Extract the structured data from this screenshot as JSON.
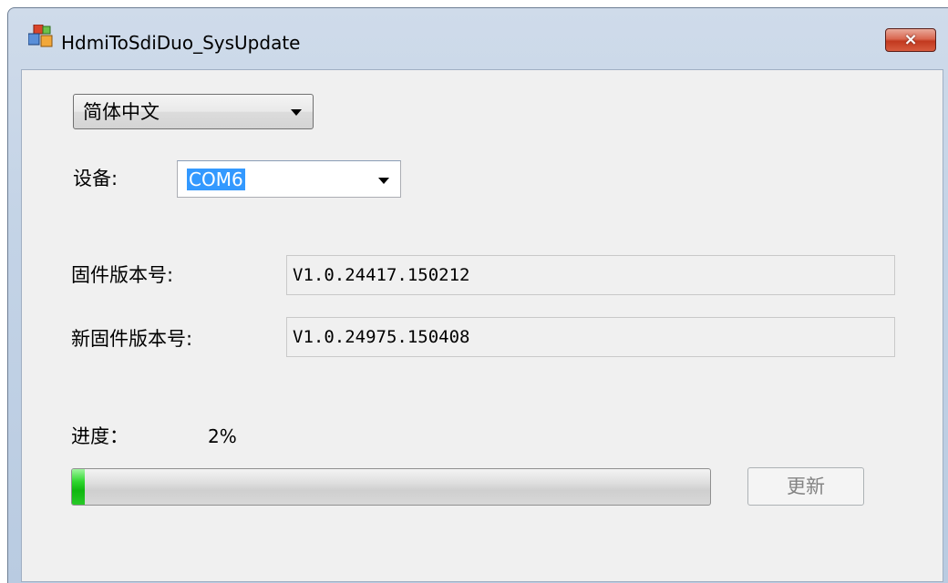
{
  "window": {
    "title": "HdmiToSdiDuo_SysUpdate",
    "close_label": "×"
  },
  "language": {
    "selected": "简体中文"
  },
  "device": {
    "label": "设备:",
    "selected": "COM6"
  },
  "firmware": {
    "label": "固件版本号:",
    "value": "V1.0.24417.150212"
  },
  "new_firmware": {
    "label": "新固件版本号:",
    "value": "V1.0.24975.150408"
  },
  "progress": {
    "label": "进度：",
    "percent_text": "2%",
    "fraction": 0.02
  },
  "update_button": {
    "label": "更新",
    "enabled": false
  },
  "icons": [
    "app-icon",
    "close-icon",
    "chevron-down-icon"
  ],
  "colors": {
    "selection": "#3399ff",
    "progress_fill": "#1bc41b",
    "close_button": "#c7442b",
    "client_background": "#f0f0f0"
  }
}
